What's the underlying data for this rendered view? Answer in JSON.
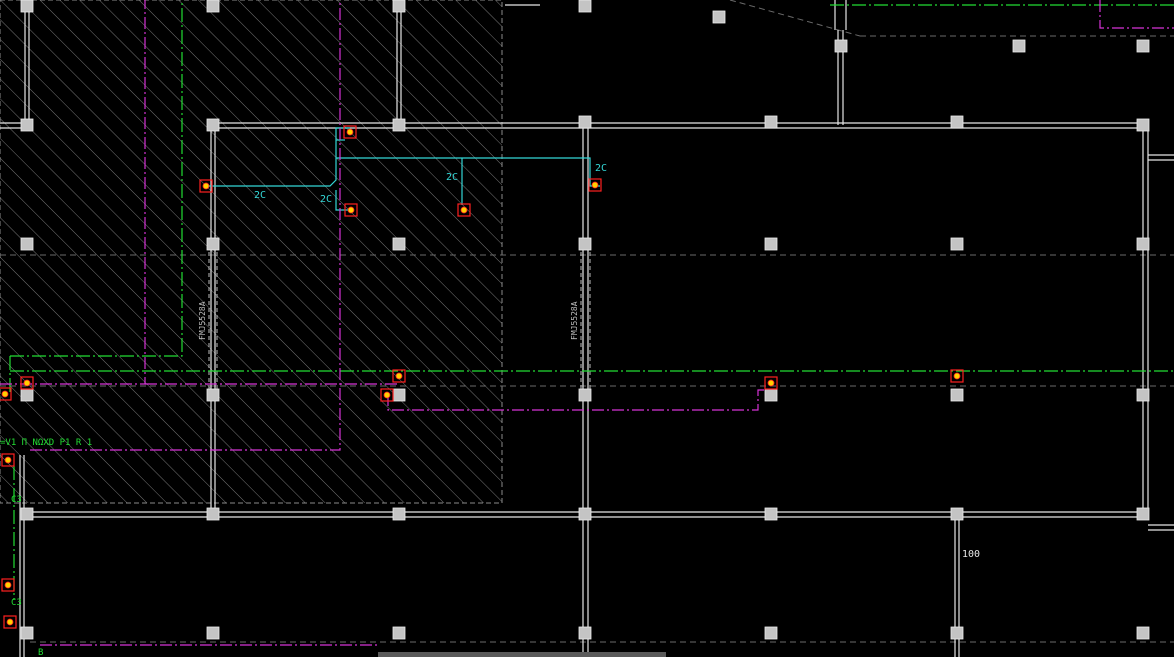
{
  "canvas": {
    "background": "#000000",
    "colors": {
      "wall": "#e6e6e6",
      "column": "#c8c8c8",
      "hatch": "#9a9a9a",
      "cyan": "#33d6d6",
      "green": "#22dd33",
      "magenta": "#d633d6",
      "device": "#ff2020",
      "device_fill": "#ffd000",
      "dashed": "#8a8a8a"
    }
  },
  "labels": {
    "cable_1": "2C",
    "cable_2": "2C",
    "cable_3": "2C",
    "cable_4": "2C",
    "beam_left": "FMJ5528A",
    "beam_mid": "FMJ5528A",
    "dimension": "100",
    "legend_green": "=V1 Π NΩXD P1 R 1",
    "left_mark_1": "C3",
    "left_mark_2": "C3",
    "left_mark_3": "B"
  },
  "scrollbar": {
    "label": "horizontal-scroll"
  }
}
